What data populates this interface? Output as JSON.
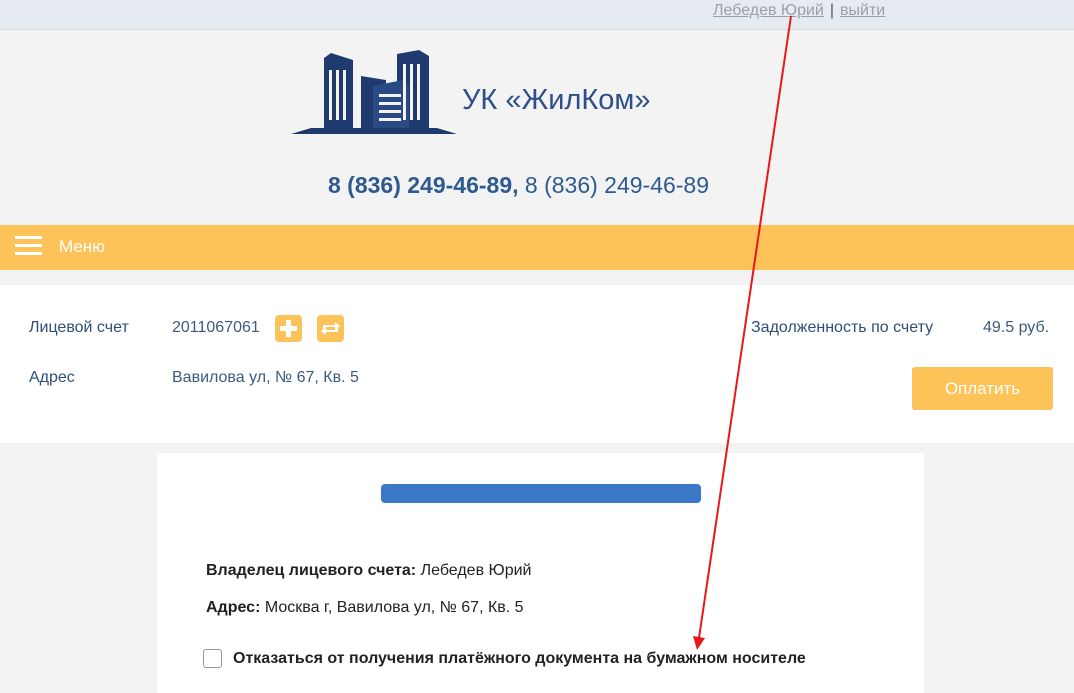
{
  "user_bar": {
    "user_name": "Лебедев Юрий",
    "separator": "|",
    "logout": "выйти"
  },
  "header": {
    "company_name": "УК «ЖилКом»",
    "phone_primary": "8 (836) 249-46-89,",
    "phone_secondary": "8 (836) 249-46-89"
  },
  "menu": {
    "label": "Меню"
  },
  "account": {
    "account_label": "Лицевой счет",
    "account_number": "2011067061",
    "address_label": "Адрес",
    "address_value": "Вавилова ул, № 67, Кв. 5",
    "debt_label": "Задолженность по счету",
    "debt_value": "49.5 руб.",
    "pay_button": "Оплатить"
  },
  "details": {
    "owner_label": "Владелец лицевого счета:",
    "owner_value": "Лебедев Юрий",
    "address_label": "Адрес:",
    "address_value": "Москва г, Вавилова ул, № 67, Кв. 5",
    "paper_refusal_label": "Отказаться от получения платёжного документа на бумажном носителе",
    "paper_refusal_checked": false
  },
  "colors": {
    "accent": "#fdc258",
    "brand": "#2e4f8a",
    "progress": "#3b78c8",
    "annotation": "#e8171b"
  },
  "icons": {
    "add": "plus-icon",
    "switch": "swap-arrows-icon",
    "logo": "buildings-logo-icon",
    "menu": "hamburger-icon"
  }
}
